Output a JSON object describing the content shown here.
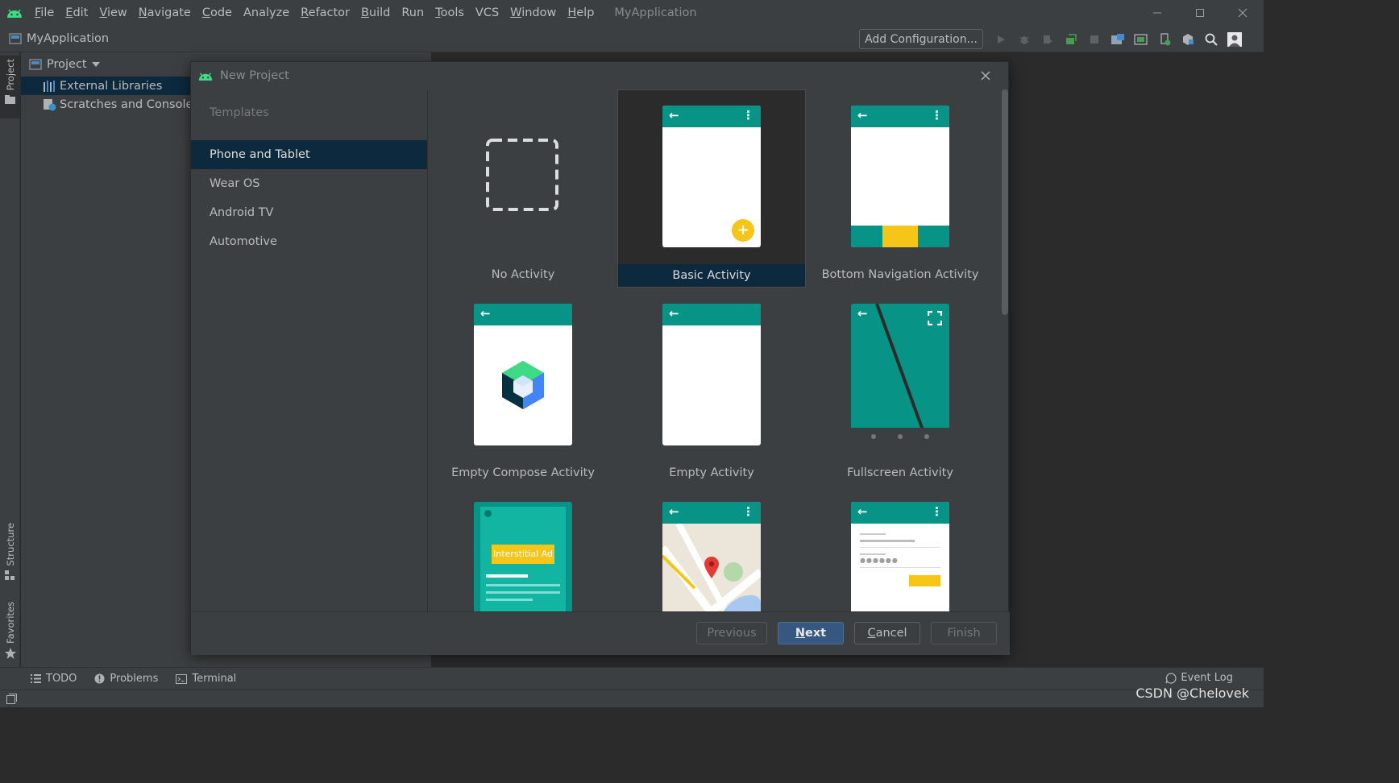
{
  "menubar": {
    "items": [
      {
        "mnemonic": "F",
        "rest": "ile"
      },
      {
        "mnemonic": "E",
        "rest": "dit"
      },
      {
        "mnemonic": "V",
        "rest": "iew"
      },
      {
        "mnemonic": "N",
        "rest": "avigate"
      },
      {
        "mnemonic": "C",
        "rest": "ode"
      },
      {
        "mnemonic": "",
        "rest": "Analyze"
      },
      {
        "mnemonic": "R",
        "rest": "efactor"
      },
      {
        "mnemonic": "B",
        "rest": "uild"
      },
      {
        "mnemonic": "",
        "rest": "Run"
      },
      {
        "mnemonic": "T",
        "rest": "ools"
      },
      {
        "mnemonic": "",
        "rest": "VCS"
      },
      {
        "mnemonic": "W",
        "rest": "indow"
      },
      {
        "mnemonic": "H",
        "rest": "elp"
      }
    ],
    "window_title": "MyApplication"
  },
  "toolbar": {
    "project_name": "MyApplication",
    "add_configuration": "Add Configuration..."
  },
  "left_strip": {
    "project_tab": "Project",
    "structure_tab": "Structure",
    "favorites_tab": "Favorites"
  },
  "project_panel": {
    "header": "Project",
    "tree": [
      "External Libraries",
      "Scratches and Consoles"
    ]
  },
  "dialog": {
    "title": "New Project",
    "section": "Templates",
    "categories": [
      "Phone and Tablet",
      "Wear OS",
      "Android TV",
      "Automotive"
    ],
    "selected_category": "Phone and Tablet",
    "templates": [
      "No Activity",
      "Basic Activity",
      "Bottom Navigation Activity",
      "Empty Compose Activity",
      "Empty Activity",
      "Fullscreen Activity"
    ],
    "selected_template": "Basic Activity",
    "interstitial_label": "Interstitial Ad",
    "buttons": {
      "previous": "Previous",
      "next_mn": "N",
      "next_rest": "ext",
      "cancel_mn": "C",
      "cancel_rest": "ancel",
      "finish": "Finish"
    }
  },
  "bottom_tools": {
    "todo": "TODO",
    "problems": "Problems",
    "terminal": "Terminal",
    "event_log": "Event Log"
  },
  "watermark": "CSDN @Chelovek",
  "colors": {
    "accent_teal": "#079486",
    "fab_yellow": "#f5c518",
    "selection": "#0d293e",
    "primary_button": "#365880"
  }
}
